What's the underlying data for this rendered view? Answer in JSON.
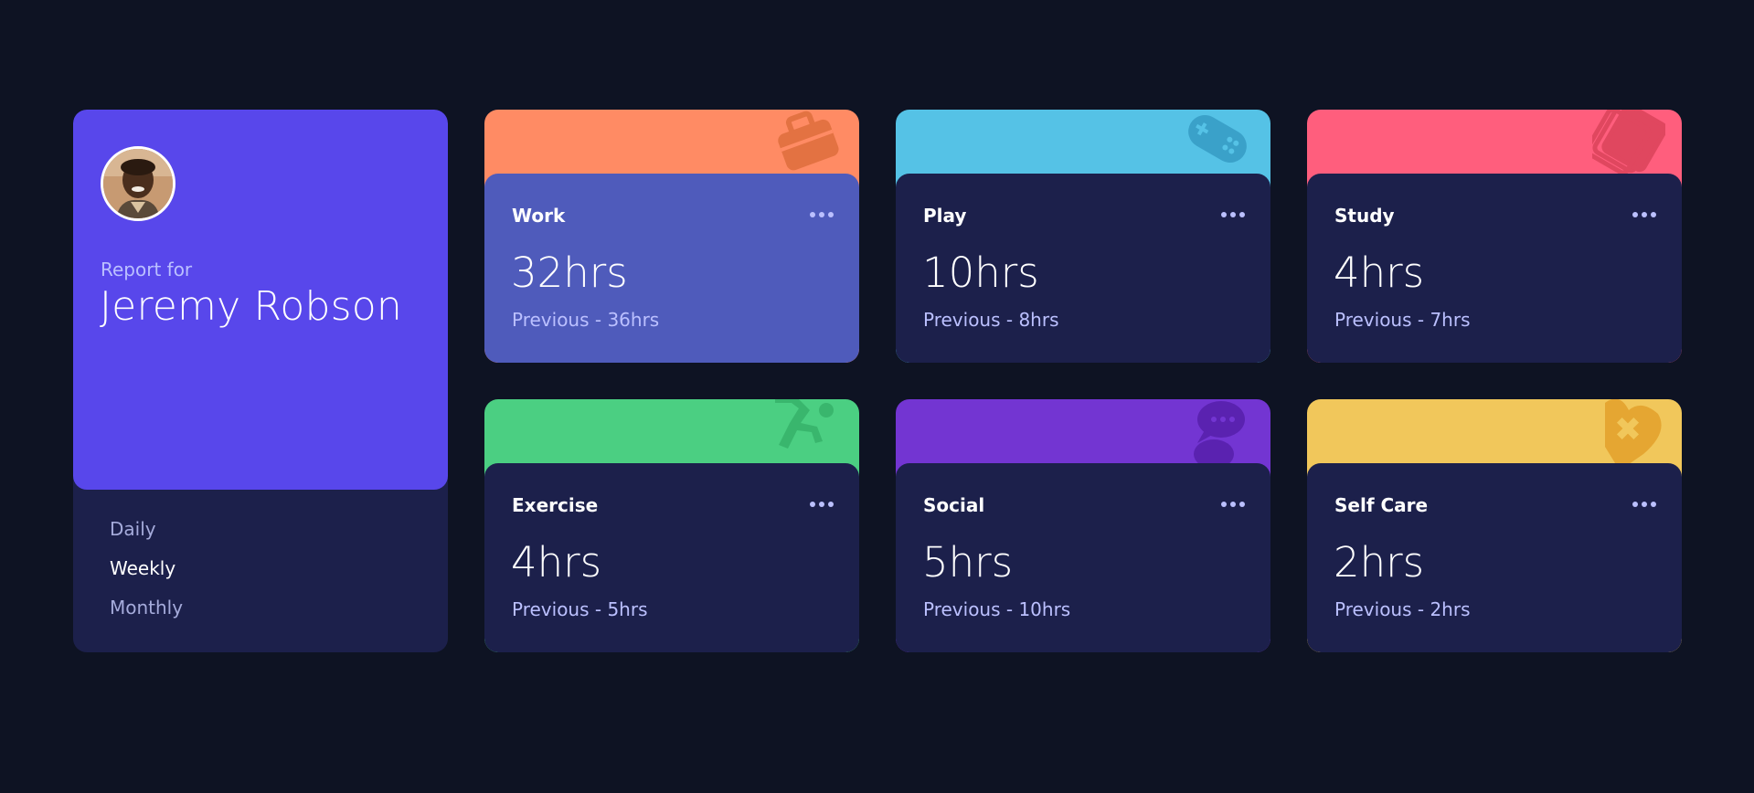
{
  "profile": {
    "report_for": "Report for",
    "name": "Jeremy Robson",
    "periods": [
      {
        "label": "Daily",
        "active": false
      },
      {
        "label": "Weekly",
        "active": true
      },
      {
        "label": "Monthly",
        "active": false
      }
    ]
  },
  "theme": {
    "background": "#0e1323",
    "card_body": "#1c204b",
    "profile_top": "#5847eb",
    "highlight_card": "#4f5bbb"
  },
  "cards": [
    {
      "title": "Work",
      "hours": "32hrs",
      "previous": "Previous - 36hrs",
      "color": "#ff8b64",
      "icon": "briefcase-icon"
    },
    {
      "title": "Play",
      "hours": "10hrs",
      "previous": "Previous - 8hrs",
      "color": "#55c2e6",
      "icon": "gamepad-icon"
    },
    {
      "title": "Study",
      "hours": "4hrs",
      "previous": "Previous - 7hrs",
      "color": "#ff5e7d",
      "icon": "book-icon"
    },
    {
      "title": "Exercise",
      "hours": "4hrs",
      "previous": "Previous - 5hrs",
      "color": "#4bcf82",
      "icon": "running-icon"
    },
    {
      "title": "Social",
      "hours": "5hrs",
      "previous": "Previous - 10hrs",
      "color": "#7335d2",
      "icon": "chat-bubbles-icon"
    },
    {
      "title": "Self Care",
      "hours": "2hrs",
      "previous": "Previous - 2hrs",
      "color": "#f1c75b",
      "icon": "heart-bandage-icon"
    }
  ]
}
